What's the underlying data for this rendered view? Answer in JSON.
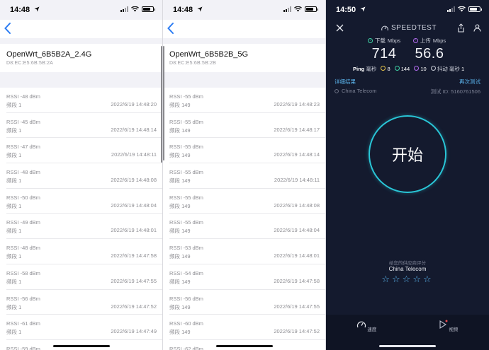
{
  "left_panel": {
    "status_time": "14:48",
    "ssid": "OpenWrt_6B5B2A_2.4G",
    "bssid": "D8:EC:E5:6B:5B:2A",
    "rows": [
      {
        "rssi": "RSSI -48 dBm",
        "band": "频段 1",
        "time": "2022/6/19 14:48:20"
      },
      {
        "rssi": "RSSI -45 dBm",
        "band": "频段 1",
        "time": "2022/6/19 14:48:14"
      },
      {
        "rssi": "RSSI -47 dBm",
        "band": "频段 1",
        "time": "2022/6/19 14:48:11"
      },
      {
        "rssi": "RSSI -48 dBm",
        "band": "频段 1",
        "time": "2022/6/19 14:48:08"
      },
      {
        "rssi": "RSSI -50 dBm",
        "band": "频段 1",
        "time": "2022/6/19 14:48:04"
      },
      {
        "rssi": "RSSI -49 dBm",
        "band": "频段 1",
        "time": "2022/6/19 14:48:01"
      },
      {
        "rssi": "RSSI -48 dBm",
        "band": "频段 1",
        "time": "2022/6/19 14:47:58"
      },
      {
        "rssi": "RSSI -58 dBm",
        "band": "频段 1",
        "time": "2022/6/19 14:47:55"
      },
      {
        "rssi": "RSSI -56 dBm",
        "band": "频段 1",
        "time": "2022/6/19 14:47:52"
      },
      {
        "rssi": "RSSI -61 dBm",
        "band": "频段 1",
        "time": "2022/6/19 14:47:49"
      },
      {
        "rssi": "RSSI -59 dBm",
        "band": "",
        "time": ""
      }
    ]
  },
  "middle_panel": {
    "status_time": "14:48",
    "ssid": "OpenWrt_6B5B2B_5G",
    "bssid": "D8:EC:E5:6B:5B:2B",
    "rows": [
      {
        "rssi": "RSSI -55 dBm",
        "band": "频段 149",
        "time": "2022/6/19 14:48:23"
      },
      {
        "rssi": "RSSI -55 dBm",
        "band": "频段 149",
        "time": "2022/6/19 14:48:17"
      },
      {
        "rssi": "RSSI -55 dBm",
        "band": "频段 149",
        "time": "2022/6/19 14:48:14"
      },
      {
        "rssi": "RSSI -55 dBm",
        "band": "频段 149",
        "time": "2022/6/19 14:48:11"
      },
      {
        "rssi": "RSSI -55 dBm",
        "band": "频段 149",
        "time": "2022/6/19 14:48:08"
      },
      {
        "rssi": "RSSI -55 dBm",
        "band": "频段 149",
        "time": "2022/6/19 14:48:04"
      },
      {
        "rssi": "RSSI -53 dBm",
        "band": "频段 149",
        "time": "2022/6/19 14:48:01"
      },
      {
        "rssi": "RSSI -54 dBm",
        "band": "频段 149",
        "time": "2022/6/19 14:47:58"
      },
      {
        "rssi": "RSSI -56 dBm",
        "band": "频段 149",
        "time": "2022/6/19 14:47:55"
      },
      {
        "rssi": "RSSI -60 dBm",
        "band": "频段 149",
        "time": "2022/6/19 14:47:52"
      },
      {
        "rssi": "RSSI -62 dBm",
        "band": "",
        "time": ""
      }
    ]
  },
  "speedtest": {
    "status_time": "14:50",
    "brand": "SPEEDTEST",
    "download": {
      "label": "下载",
      "unit": "Mbps",
      "value": "714"
    },
    "upload": {
      "label": "上传",
      "unit": "Mbps",
      "value": "56.6"
    },
    "ping": {
      "label": "Ping",
      "unit": "毫秒",
      "idle": "8",
      "down": "144",
      "up": "10"
    },
    "jitter": {
      "label": "抖动",
      "unit": "毫秒",
      "value": "1"
    },
    "details_link": "详细结果",
    "retest_link": "再次测试",
    "isp": "China Telecom",
    "test_id": "测试 ID: 5160761506",
    "go_label": "开始",
    "rate_prompt": "给您的供应商评分",
    "rate_isp": "China Telecom",
    "stars": "☆☆☆☆☆",
    "tabs": {
      "speed": "速度",
      "video": "视频"
    },
    "colors": {
      "bg": "#141a2e",
      "accent": "#29c5d6",
      "link": "#5ab2ea",
      "download": "#3fd2a6",
      "upload": "#b36cf0"
    }
  }
}
